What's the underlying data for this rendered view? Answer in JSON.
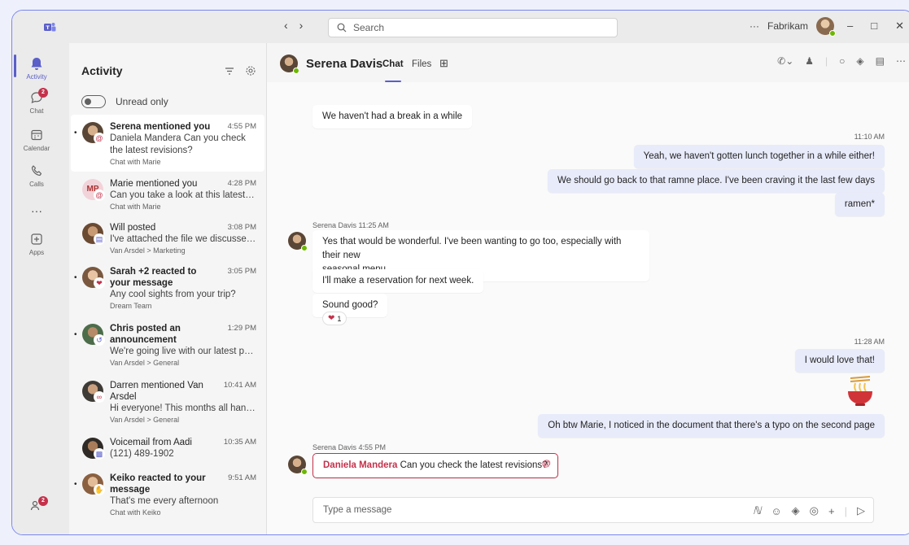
{
  "titlebar": {
    "search_placeholder": "Search",
    "more": "···",
    "org_name": "Fabrikam"
  },
  "rail": {
    "items": [
      {
        "label": "Activity",
        "icon": "bell-icon"
      },
      {
        "label": "Chat",
        "icon": "chat-icon",
        "badge": "2"
      },
      {
        "label": "Calendar",
        "icon": "calendar-icon"
      },
      {
        "label": "Calls",
        "icon": "phone-icon"
      },
      {
        "label": "···",
        "icon": "more-icon"
      },
      {
        "label": "Apps",
        "icon": "apps-icon"
      }
    ],
    "bottom_badge": "2"
  },
  "activity": {
    "title": "Activity",
    "toggle_label": "Unread only",
    "items": [
      {
        "title": "Serena mentioned you",
        "time": "4:55 PM",
        "body": "Daniela Mandera Can you check the latest revisions?",
        "context": "Chat with Marie",
        "unread": true
      },
      {
        "title": "Marie mentioned you",
        "time": "4:28 PM",
        "body": "Can you take a look at this latest file?",
        "context": "Chat with Marie",
        "unread": false,
        "initials": "MP"
      },
      {
        "title": "Will posted",
        "time": "3:08 PM",
        "body": "I've attached the file we discussed...",
        "context": "Van Arsdel > Marketing",
        "unread": false
      },
      {
        "title": "Sarah +2 reacted to your message",
        "time": "3:05 PM",
        "body": "Any cool sights from your trip?",
        "context": "Dream Team",
        "unread": true
      },
      {
        "title": "Chris posted an announcement",
        "time": "1:29 PM",
        "body": "We're going live with our latest pro...",
        "context": "Van Arsdel > General",
        "unread": true
      },
      {
        "title": "Darren mentioned Van Arsdel",
        "time": "10:41 AM",
        "body": "Hi everyone! This months all hands...",
        "context": "Van Arsdel > General",
        "unread": false
      },
      {
        "title": "Voicemail from Aadi",
        "time": "10:35 AM",
        "body": "(121) 489-1902",
        "context": "",
        "unread": false
      },
      {
        "title": "Keiko reacted to your message",
        "time": "9:51 AM",
        "body": "That's me every afternoon",
        "context": "Chat with Keiko",
        "unread": true
      }
    ]
  },
  "chat": {
    "name": "Serena Davis",
    "tabs": [
      "Chat",
      "Files"
    ],
    "messages": {
      "m1": "We haven't had a break in a while",
      "t1": "11:10 AM",
      "m2": "Yeah, we haven't gotten lunch together in a while either!",
      "m3": "We should go back to that ramne place. I've been craving it the last few days",
      "m4": "ramen*",
      "meta1": "Serena Davis  11:25 AM",
      "m5a": "Yes that would be wonderful. I've been wanting to go too, especially with their new",
      "m5b": "seasonal menu.",
      "m6": "I'll make a reservation for next week.",
      "m7": "Sound good?",
      "reaction_count": "1",
      "t2": "11:28 AM",
      "m8": "I would love that!",
      "m9": "Oh btw Marie, I noticed in the document that there's a typo on the second page",
      "meta2": "Serena Davis  4:55 PM",
      "m10_mention": "Daniela Mandera",
      "m10_text": " Can you check the latest revisions?"
    },
    "composer_placeholder": "Type a message"
  },
  "colors": {
    "accent": "#5b5fc7",
    "mention": "#c4314b",
    "presence": "#6bb700",
    "my_bubble": "#e8ebfa"
  }
}
